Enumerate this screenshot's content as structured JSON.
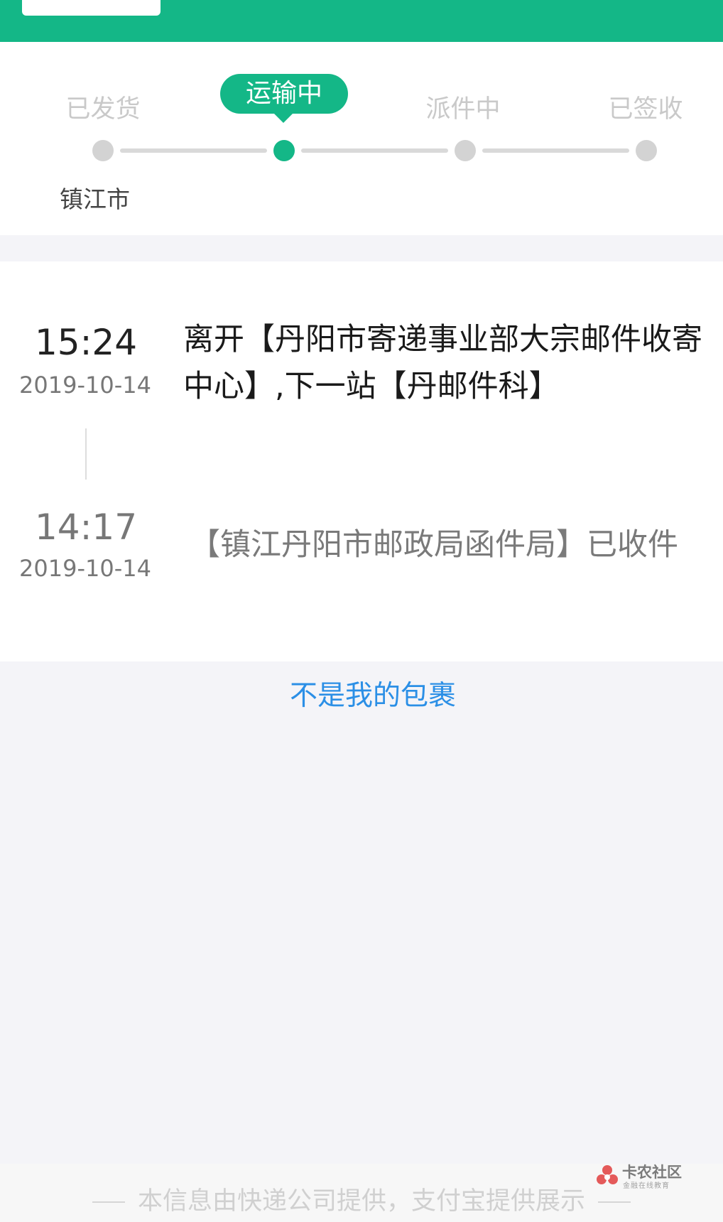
{
  "progress": {
    "steps": [
      {
        "label": "已发货",
        "state": "done"
      },
      {
        "label": "运输中",
        "state": "active"
      },
      {
        "label": "派件中",
        "state": "pending"
      },
      {
        "label": "已签收",
        "state": "pending"
      }
    ],
    "current_location": "镇江市"
  },
  "timeline": [
    {
      "time": "15:24",
      "date": "2019-10-14",
      "text": "离开【丹阳市寄递事业部大宗邮件收寄中心】,下一站【丹邮件科】"
    },
    {
      "time": "14:17",
      "date": "2019-10-14",
      "text": "【镇江丹阳市邮政局函件局】已收件"
    }
  ],
  "link_not_mine": "不是我的包裹",
  "footer": {
    "text": "本信息由快递公司提供，支付宝提供展示"
  },
  "watermark": {
    "title": "卡农社区",
    "subtitle": "金融在线教育"
  },
  "colors": {
    "accent": "#14b787",
    "link": "#2b8fe6"
  }
}
